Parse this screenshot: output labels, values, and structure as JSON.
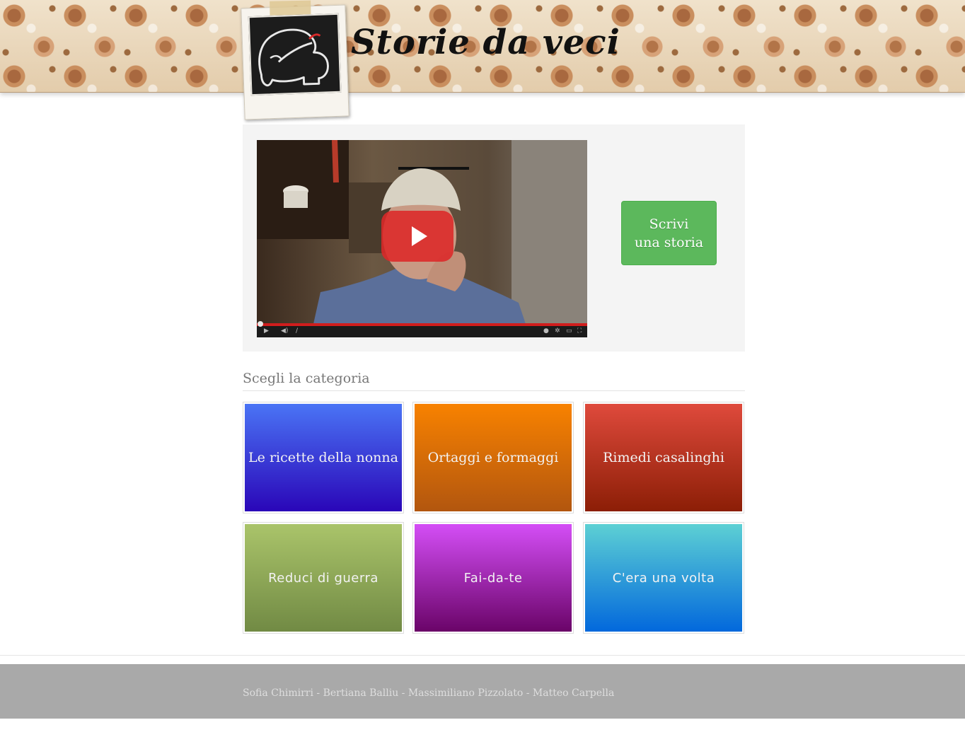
{
  "site": {
    "title": "Storie da veci",
    "colors": {
      "accent_green": "#5cb85c",
      "video_progress": "#d01d1d",
      "footer_bg": "#a9a9a9"
    }
  },
  "hero": {
    "video": {
      "play_icon": "play-icon",
      "progress_fraction": 0.0,
      "time_separator": "/"
    },
    "write_button": {
      "label": "Scrivi\nuna storia"
    }
  },
  "categories": {
    "heading": "Scegli la categoria",
    "items": [
      {
        "label": "Le ricette della nonna",
        "color_top": "#4a74f5",
        "color_bottom": "#2a06b8"
      },
      {
        "label": "Ortaggi e formaggi",
        "color_top": "#f88200",
        "color_bottom": "#b2560f"
      },
      {
        "label": "Rimedi casalinghi",
        "color_top": "#df4a3c",
        "color_bottom": "#8c1e06"
      },
      {
        "label": "Reduci di guerra",
        "color_top": "#aac46a",
        "color_bottom": "#718a44"
      },
      {
        "label": "Fai-da-te",
        "color_top": "#d44ef6",
        "color_bottom": "#6a0468"
      },
      {
        "label": "C'era una volta",
        "color_top": "#5dd0d4",
        "color_bottom": "#0268dc"
      }
    ]
  },
  "footer": {
    "credits": "Sofia Chimirri - Bertiana Balliu - Massimiliano Pizzolato - Matteo Carpella"
  }
}
